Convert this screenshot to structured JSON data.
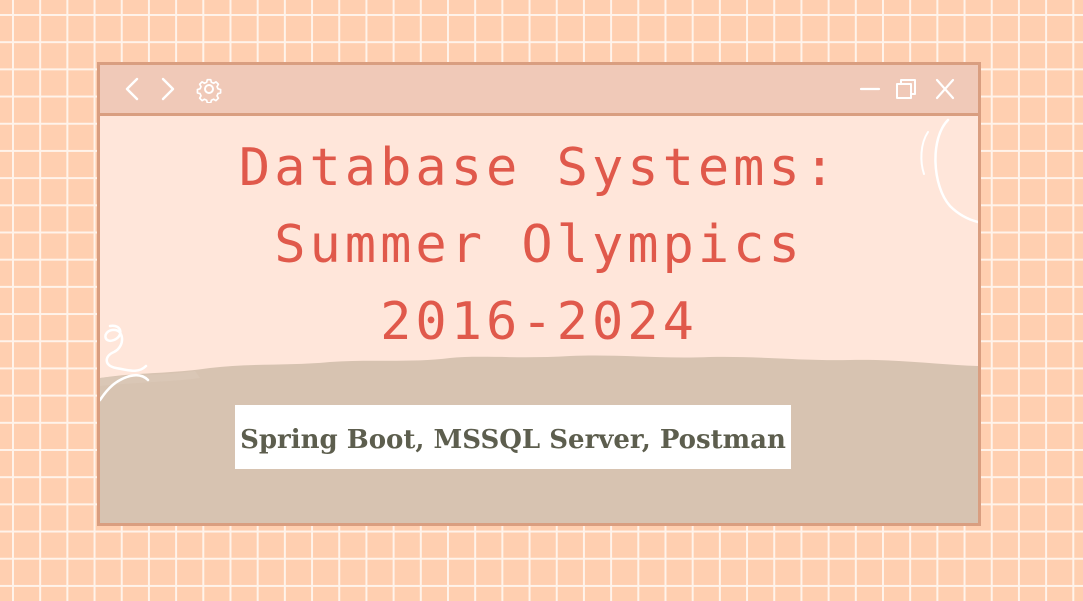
{
  "window": {
    "controls": {
      "back": "chevron-left-icon",
      "forward": "chevron-right-icon",
      "settings": "gear-icon",
      "minimize": "minimize-icon",
      "restore": "restore-icon",
      "close": "close-icon"
    }
  },
  "slide": {
    "title_lines": [
      "Database Systems:",
      "Summer Olympics",
      "2016-2024"
    ],
    "subtitle": "Spring Boot, MSSQL Server, Postman"
  },
  "colors": {
    "background": "#ffcfb0",
    "grid_lines": "#fff3ea",
    "window_fill": "#ffe6da",
    "window_border": "#d99e80",
    "titlebar_fill": "#f0c9b8",
    "title_text": "#e0594b",
    "ground_fill": "#d7c3b1",
    "subtitle_box": "#ffffff",
    "subtitle_text": "#5d5e4e"
  }
}
